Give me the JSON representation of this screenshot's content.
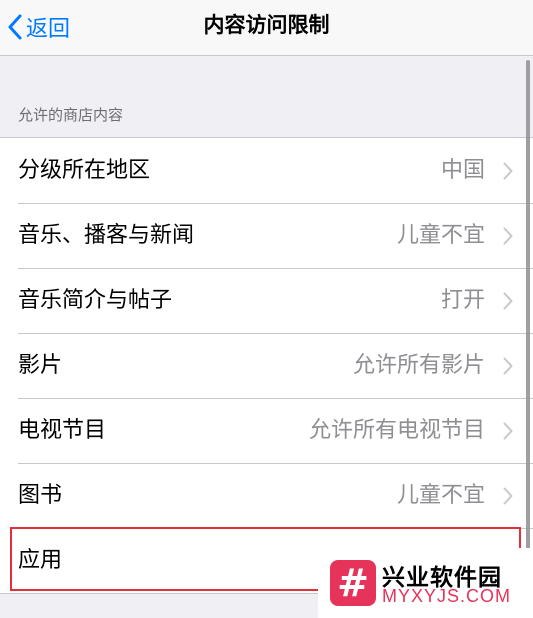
{
  "navbar": {
    "back_label": "返回",
    "title": "内容访问限制"
  },
  "section": {
    "header": "允许的商店内容"
  },
  "rows": [
    {
      "label": "分级所在地区",
      "value": "中国"
    },
    {
      "label": "音乐、播客与新闻",
      "value": "儿童不宜"
    },
    {
      "label": "音乐简介与帖子",
      "value": "打开"
    },
    {
      "label": "影片",
      "value": "允许所有影片"
    },
    {
      "label": "电视节目",
      "value": "允许所有电视节目"
    },
    {
      "label": "图书",
      "value": "儿童不宜"
    },
    {
      "label": "应用",
      "value": ""
    }
  ],
  "watermark": {
    "logo_glyph": "#",
    "title": "兴业软件园",
    "url": "MYXYJS.COM"
  },
  "colors": {
    "accent": "#007aff",
    "highlight": "#e0303a",
    "watermark": "#e6335a"
  },
  "icons": {
    "back": "chevron-left-icon",
    "row_disclosure": "chevron-right-icon"
  }
}
